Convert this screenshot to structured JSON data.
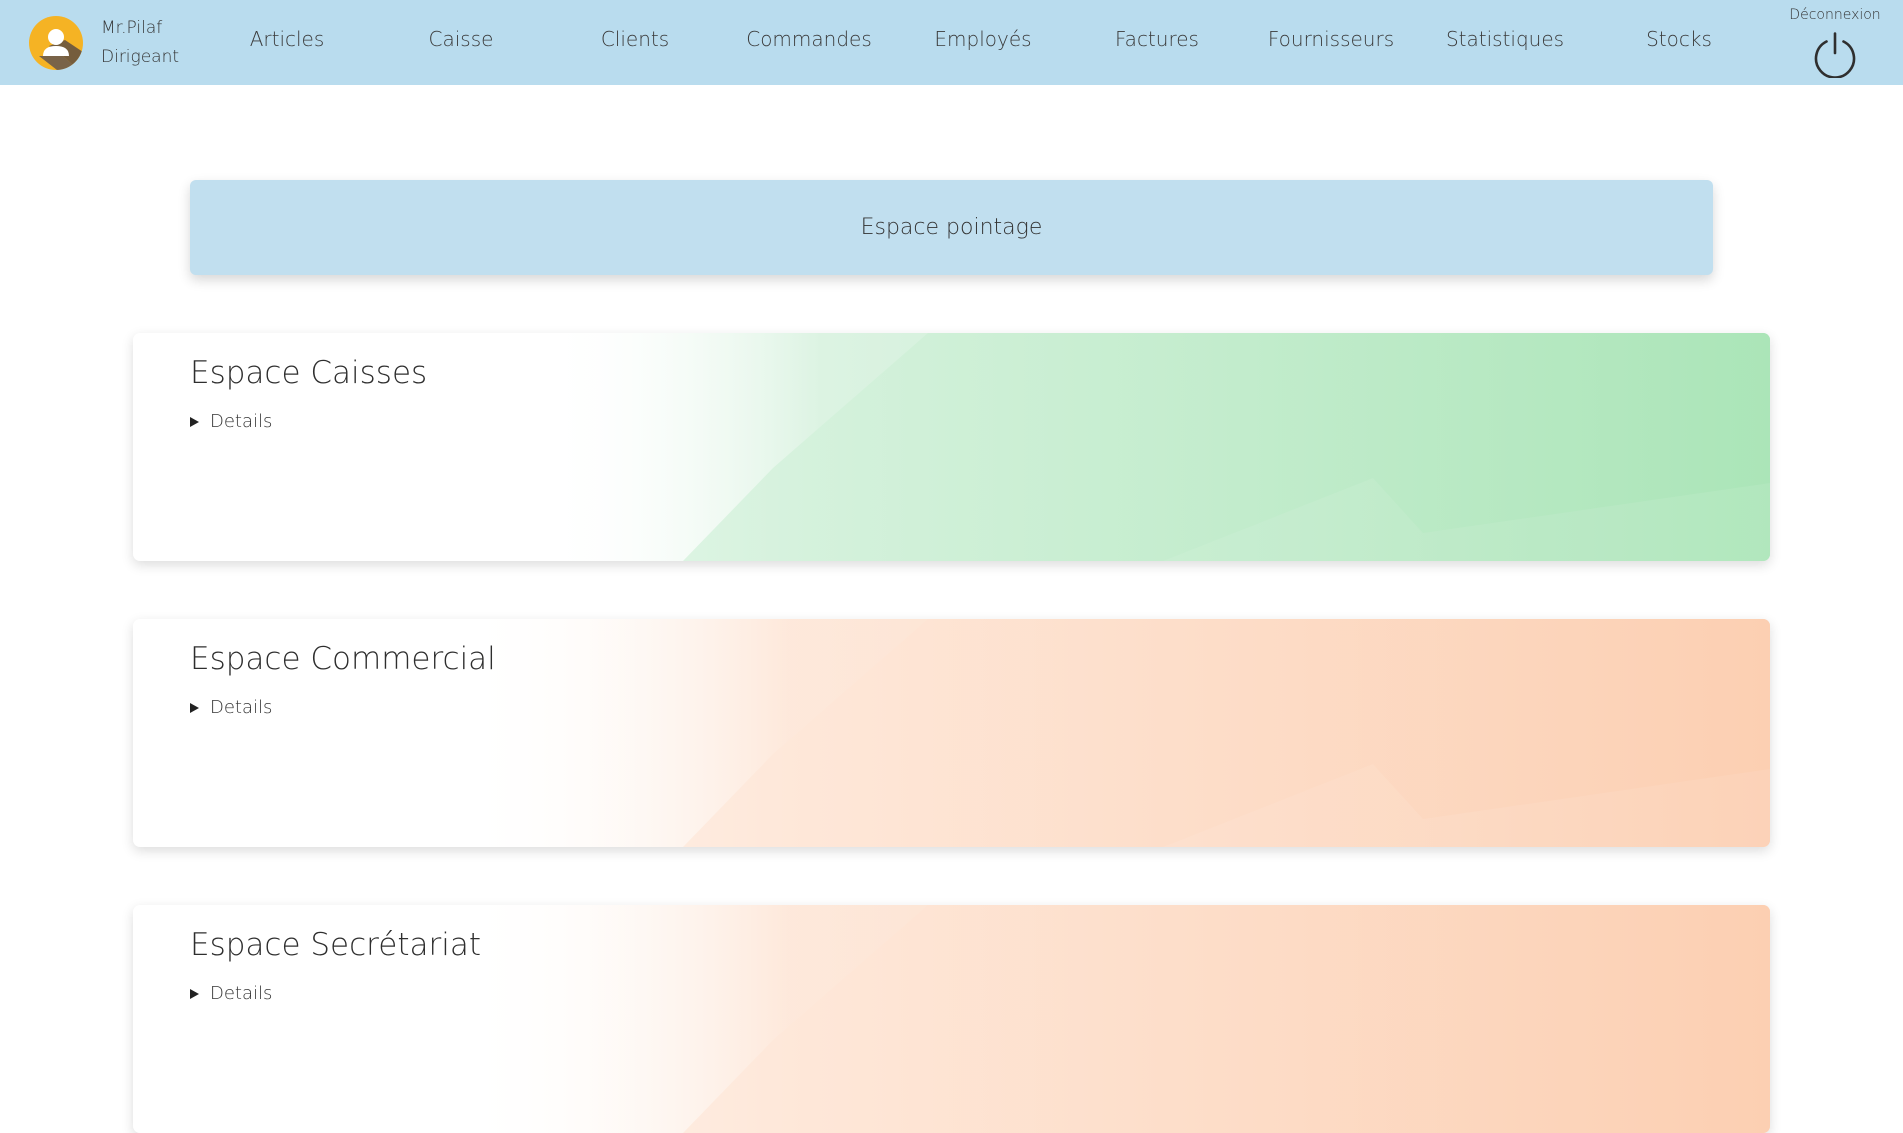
{
  "user": {
    "name": "Mr.Pilaf",
    "role": "Dirigeant"
  },
  "nav": {
    "items": [
      {
        "label": "Articles"
      },
      {
        "label": "Caisse"
      },
      {
        "label": "Clients"
      },
      {
        "label": "Commandes"
      },
      {
        "label": "Employés"
      },
      {
        "label": "Factures"
      },
      {
        "label": "Fournisseurs"
      },
      {
        "label": "Statistiques"
      },
      {
        "label": "Stocks"
      }
    ],
    "logout_label": "Déconnexion"
  },
  "main": {
    "pointage_label": "Espace pointage",
    "cards": [
      {
        "title": "Espace Caisses",
        "details_label": "Details",
        "color": "#abe5b8"
      },
      {
        "title": "Espace Commercial",
        "details_label": "Details",
        "color": "#fccfb2"
      },
      {
        "title": "Espace Secrétariat",
        "details_label": "Details",
        "color": "#fccfb2"
      }
    ]
  },
  "colors": {
    "navbar": "#b9dcee",
    "pointage": "#c1dfef",
    "avatar": "#f5b324"
  },
  "icons": {
    "avatar": "user-avatar-icon",
    "logout": "power-icon",
    "details": "triangle-right-icon"
  }
}
